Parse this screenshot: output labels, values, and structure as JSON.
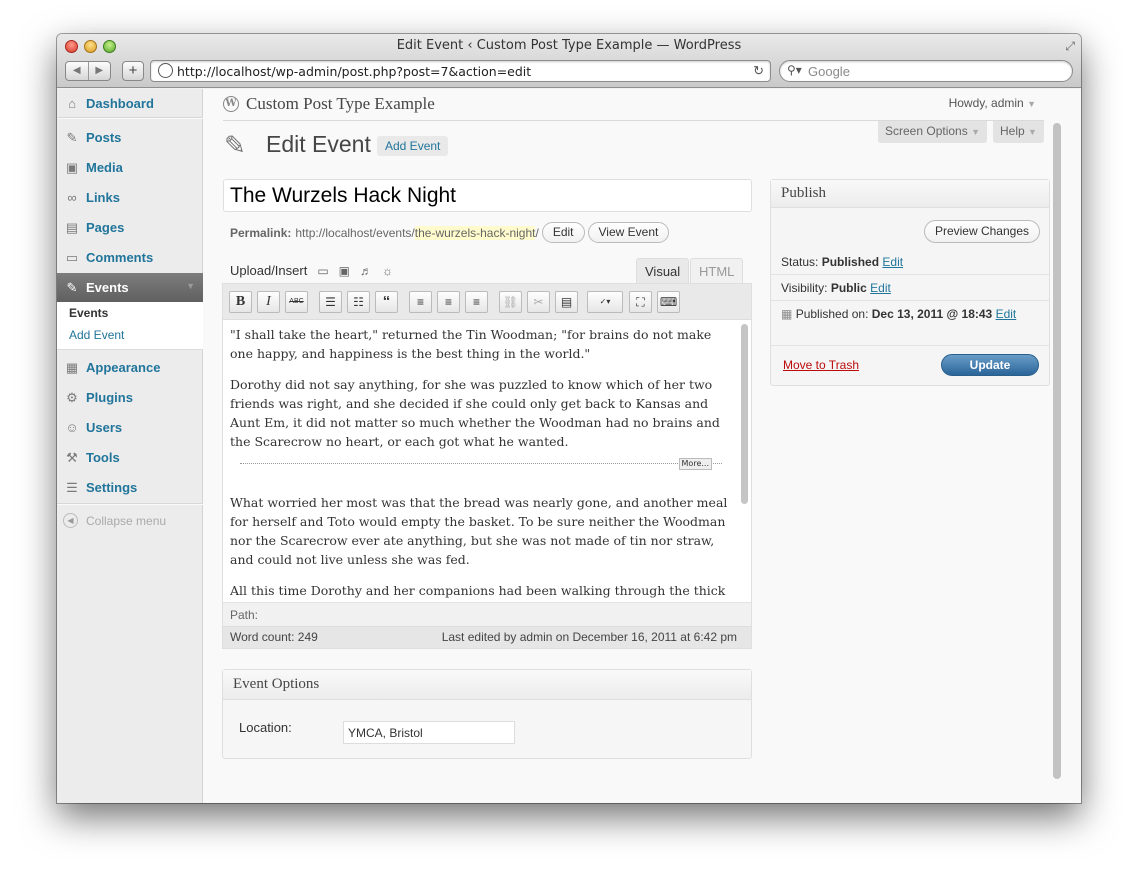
{
  "window": {
    "title": "Edit Event ‹ Custom Post Type Example — WordPress",
    "url": "http://localhost/wp-admin/post.php?post=7&action=edit",
    "search_placeholder": "Google"
  },
  "sidebar": {
    "items": [
      {
        "label": "Dashboard",
        "icon": "dashboard-icon",
        "glyph": "⌂"
      },
      {
        "label": "Posts",
        "icon": "pin-icon",
        "glyph": "✎"
      },
      {
        "label": "Media",
        "icon": "media-icon",
        "glyph": "▣"
      },
      {
        "label": "Links",
        "icon": "link-icon",
        "glyph": "∞"
      },
      {
        "label": "Pages",
        "icon": "pages-icon",
        "glyph": "▤"
      },
      {
        "label": "Comments",
        "icon": "comment-icon",
        "glyph": "▭"
      },
      {
        "label": "Events",
        "icon": "pin-icon",
        "glyph": "✎"
      },
      {
        "label": "Appearance",
        "icon": "appearance-icon",
        "glyph": "▦"
      },
      {
        "label": "Plugins",
        "icon": "plugin-icon",
        "glyph": "⚙"
      },
      {
        "label": "Users",
        "icon": "users-icon",
        "glyph": "☺"
      },
      {
        "label": "Tools",
        "icon": "tools-icon",
        "glyph": "⚒"
      },
      {
        "label": "Settings",
        "icon": "settings-icon",
        "glyph": "☰"
      }
    ],
    "submenu": [
      "Events",
      "Add Event"
    ],
    "collapse_label": "Collapse menu"
  },
  "header": {
    "site_title": "Custom Post Type Example",
    "howdy": "Howdy, admin",
    "screen_options": "Screen Options",
    "help": "Help"
  },
  "page": {
    "title": "Edit Event",
    "add_new": "Add Event",
    "post_title": "The Wurzels Hack Night",
    "permalink_label": "Permalink:",
    "permalink_base": "http://localhost/events/",
    "permalink_slug": "the-wurzels-hack-night",
    "permalink_tail": "/",
    "edit_btn": "Edit",
    "view_btn": "View Event"
  },
  "editor": {
    "upload_label": "Upload/Insert",
    "tab_visual": "Visual",
    "tab_html": "HTML",
    "paragraphs": [
      "\"I shall take the heart,\" returned the Tin Woodman; \"for brains do not make one happy, and happiness is the best thing in the world.\"",
      "Dorothy did not say anything, for she was puzzled to know which of her two friends was right, and she decided if she could only get back to Kansas and Aunt Em, it did not matter so much whether the Woodman had no brains and the Scarecrow no heart, or each got what he wanted.",
      "What worried her most was that the bread was nearly gone, and another meal for herself and Toto would empty the basket. To be sure neither the Woodman nor the Scarecrow ever ate anything, but she was not made of tin nor straw, and could not live unless she was fed.",
      "All this time Dorothy and her companions had been walking through the thick woods."
    ],
    "more_tag": "More...",
    "path_label": "Path:",
    "word_count": "Word count: 249",
    "last_edited": "Last edited by admin on December 16, 2011 at 6:42 pm"
  },
  "event_options": {
    "title": "Event Options",
    "location_label": "Location:",
    "location_value": "YMCA, Bristol"
  },
  "publish": {
    "title": "Publish",
    "preview_btn": "Preview Changes",
    "status_label": "Status:",
    "status_value": "Published",
    "visibility_label": "Visibility:",
    "visibility_value": "Public",
    "published_label": "Published on:",
    "published_value": "Dec 13, 2011 @ 18:43",
    "edit": "Edit",
    "trash": "Move to Trash",
    "update": "Update"
  },
  "colors": {
    "link": "#21759b",
    "active_menu": "#6d6d6d",
    "update_button": "#2a6599",
    "trash": "#bc0b0b"
  }
}
